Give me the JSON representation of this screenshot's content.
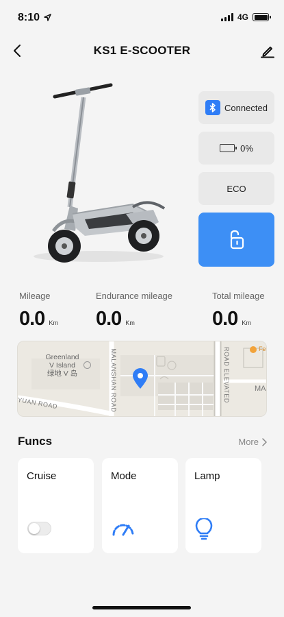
{
  "status_bar": {
    "time": "8:10",
    "network": "4G",
    "icons": [
      "location-arrow-icon",
      "signal-bars-icon",
      "battery-icon"
    ]
  },
  "header": {
    "title": "KS1 E-SCOOTER",
    "back_icon": "chevron-left-icon",
    "edit_icon": "edit-pencil-icon"
  },
  "device_panel": {
    "bluetooth_status": "Connected",
    "battery_level": "0%",
    "ride_mode": "ECO",
    "lock_icon": "unlocked-padlock-icon"
  },
  "stats": [
    {
      "label": "Mileage",
      "value": "0.0",
      "unit": "Km"
    },
    {
      "label": "Endurance mileage",
      "value": "0.0",
      "unit": "Km"
    },
    {
      "label": "Total mileage",
      "value": "0.0",
      "unit": "Km"
    }
  ],
  "map": {
    "place_label_en": "Greenland",
    "place_label_line2": "V Island",
    "place_label_cn": "绿地 V 岛",
    "roads": [
      "MALANSHAN ROAD",
      "ROAD ELEVATED",
      "YUAN ROAD"
    ],
    "edge_labels": [
      "Fe",
      "MA"
    ],
    "marker_icon": "location-pin-icon"
  },
  "funcs": {
    "title": "Funcs",
    "more_label": "More",
    "cards": [
      {
        "label": "Cruise",
        "control": "toggle",
        "enabled": false
      },
      {
        "label": "Mode",
        "icon": "speedometer-icon"
      },
      {
        "label": "Lamp",
        "icon": "lightbulb-icon"
      }
    ]
  },
  "colors": {
    "accent": "#3d8ff5",
    "bluetooth": "#2f7df6",
    "background": "#f4f4f4",
    "card": "#ffffff",
    "chip": "#e9e9e9"
  }
}
